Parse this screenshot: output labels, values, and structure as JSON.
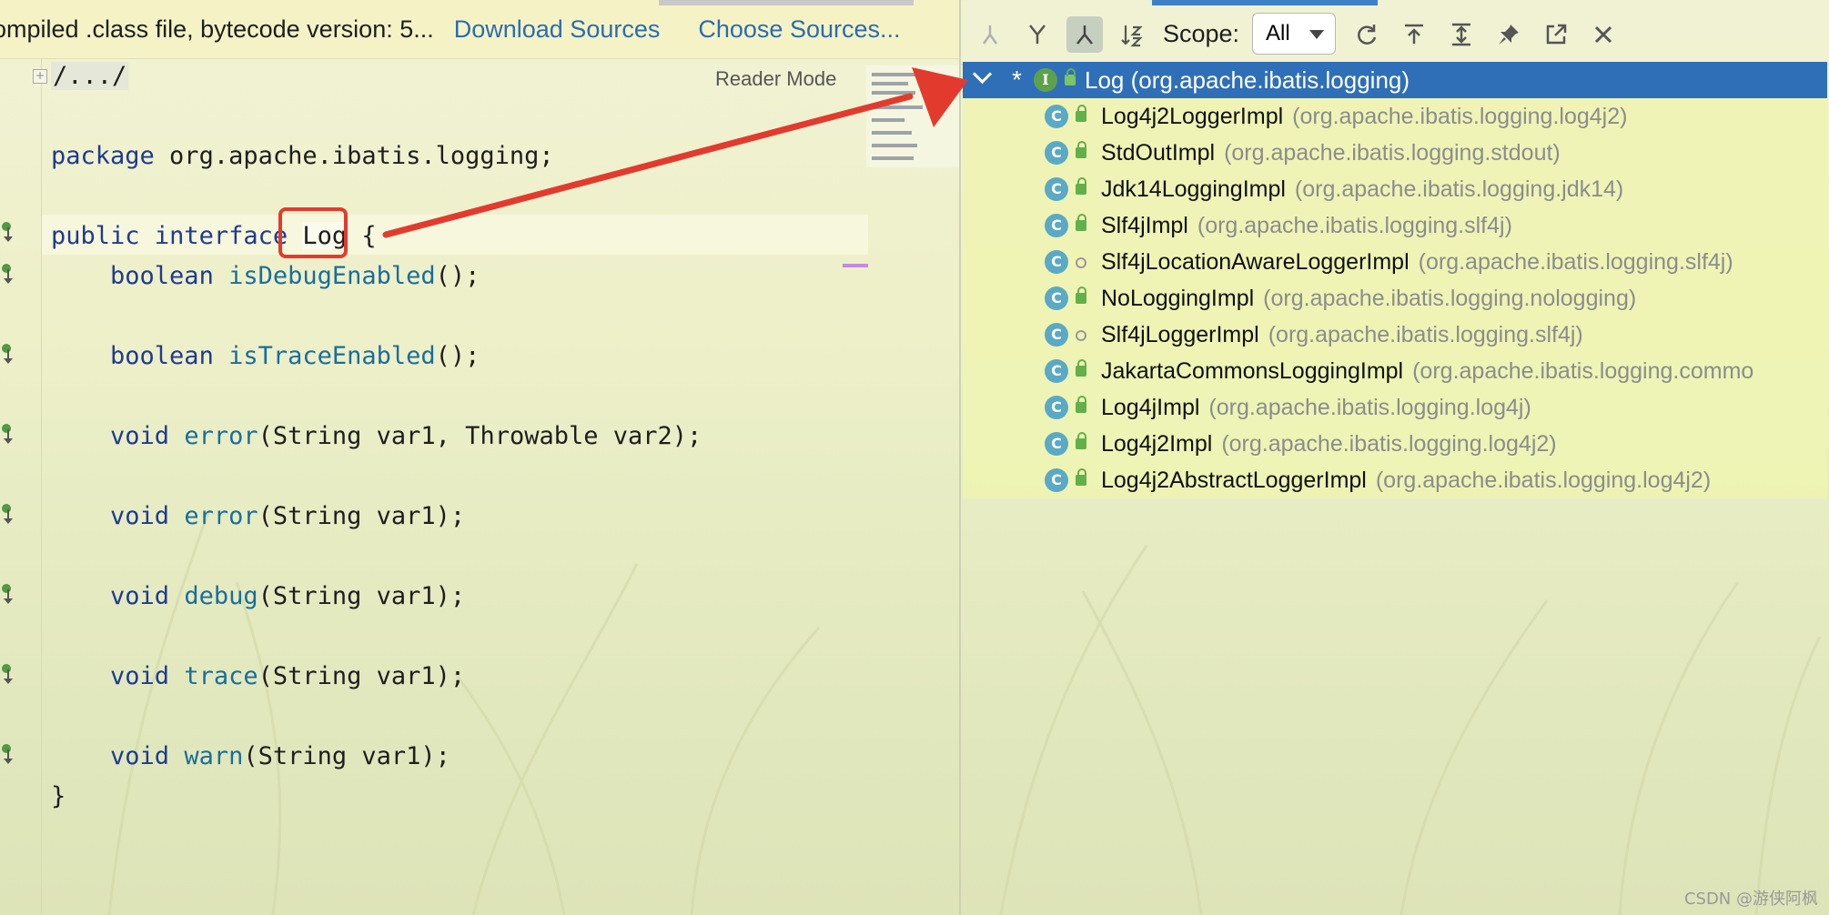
{
  "banner": {
    "message": "ompiled .class file, bytecode version: 5...",
    "download_sources": "Download Sources",
    "choose_sources": "Choose Sources..."
  },
  "editor": {
    "reader_mode": "Reader Mode",
    "collapsed_header": "/.../",
    "fold_glyph": "+",
    "lines": {
      "package_kw": "package",
      "package_name": " org.apache.ibatis.logging;",
      "public_kw": "public",
      "interface_kw": "interface",
      "class_name": "Log",
      "brace_open": " {",
      "brace_close": "}",
      "m1_type": "boolean",
      "m1_name": "isDebugEnabled",
      "m1_rest": "();",
      "m2_type": "boolean",
      "m2_name": "isTraceEnabled",
      "m2_rest": "();",
      "m3_type": "void",
      "m3_name": "error",
      "m3_rest": "(String var1, Throwable var2);",
      "m4_type": "void",
      "m4_name": "error",
      "m4_rest": "(String var1);",
      "m5_type": "void",
      "m5_name": "debug",
      "m5_rest": "(String var1);",
      "m6_type": "void",
      "m6_name": "trace",
      "m6_rest": "(String var1);",
      "m7_type": "void",
      "m7_name": "warn",
      "m7_rest": "(String var1);"
    }
  },
  "hierarchy": {
    "scope_label": "Scope:",
    "scope_value": "All",
    "root": {
      "star": "*",
      "icon_letter": "I",
      "name": "Log",
      "package": "(org.apache.ibatis.logging)"
    },
    "class_icon_letter": "C",
    "items": [
      {
        "name": "Log4j2LoggerImpl",
        "package": "(org.apache.ibatis.logging.log4j2)"
      },
      {
        "name": "StdOutImpl",
        "package": "(org.apache.ibatis.logging.stdout)"
      },
      {
        "name": "Jdk14LoggingImpl",
        "package": "(org.apache.ibatis.logging.jdk14)"
      },
      {
        "name": "Slf4jImpl",
        "package": "(org.apache.ibatis.logging.slf4j)"
      },
      {
        "name": "Slf4jLocationAwareLoggerImpl",
        "package": "(org.apache.ibatis.logging.slf4j)"
      },
      {
        "name": "NoLoggingImpl",
        "package": "(org.apache.ibatis.logging.nologging)"
      },
      {
        "name": "Slf4jLoggerImpl",
        "package": "(org.apache.ibatis.logging.slf4j)"
      },
      {
        "name": "JakartaCommonsLoggingImpl",
        "package": "(org.apache.ibatis.logging.commo"
      },
      {
        "name": "Log4jImpl",
        "package": "(org.apache.ibatis.logging.log4j)"
      },
      {
        "name": "Log4j2Impl",
        "package": "(org.apache.ibatis.logging.log4j2)"
      },
      {
        "name": "Log4j2AbstractLoggerImpl",
        "package": "(org.apache.ibatis.logging.log4j2)"
      }
    ]
  },
  "watermark": "CSDN @游侠阿枫",
  "colors": {
    "selection": "#2f6fb8",
    "annotation_red": "#e23b2e",
    "link": "#2a6db0",
    "keyword": "#1f3b8f"
  }
}
